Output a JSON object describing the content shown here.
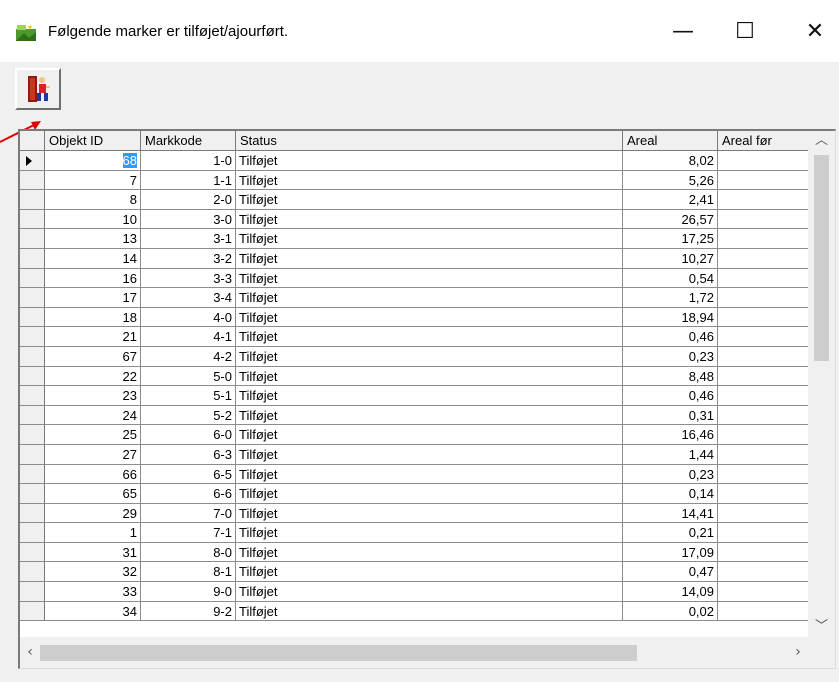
{
  "window": {
    "title": "Følgende marker er tilføjet/ajourført.",
    "minimize_glyph": "—",
    "maximize_glyph": "☐",
    "close_glyph": "✕"
  },
  "toolbar": {
    "exit_icon": "exit-door-icon"
  },
  "grid": {
    "columns": [
      "Objekt ID",
      "Markkode",
      "Status",
      "Areal",
      "Areal før"
    ],
    "rows": [
      {
        "id": "68",
        "code": "1-0",
        "status": "Tilføjet",
        "areal": "8,02",
        "areal_for": ""
      },
      {
        "id": "7",
        "code": "1-1",
        "status": "Tilføjet",
        "areal": "5,26",
        "areal_for": ""
      },
      {
        "id": "8",
        "code": "2-0",
        "status": "Tilføjet",
        "areal": "2,41",
        "areal_for": ""
      },
      {
        "id": "10",
        "code": "3-0",
        "status": "Tilføjet",
        "areal": "26,57",
        "areal_for": ""
      },
      {
        "id": "13",
        "code": "3-1",
        "status": "Tilføjet",
        "areal": "17,25",
        "areal_for": ""
      },
      {
        "id": "14",
        "code": "3-2",
        "status": "Tilføjet",
        "areal": "10,27",
        "areal_for": ""
      },
      {
        "id": "16",
        "code": "3-3",
        "status": "Tilføjet",
        "areal": "0,54",
        "areal_for": ""
      },
      {
        "id": "17",
        "code": "3-4",
        "status": "Tilføjet",
        "areal": "1,72",
        "areal_for": ""
      },
      {
        "id": "18",
        "code": "4-0",
        "status": "Tilføjet",
        "areal": "18,94",
        "areal_for": ""
      },
      {
        "id": "21",
        "code": "4-1",
        "status": "Tilføjet",
        "areal": "0,46",
        "areal_for": ""
      },
      {
        "id": "67",
        "code": "4-2",
        "status": "Tilføjet",
        "areal": "0,23",
        "areal_for": ""
      },
      {
        "id": "22",
        "code": "5-0",
        "status": "Tilføjet",
        "areal": "8,48",
        "areal_for": ""
      },
      {
        "id": "23",
        "code": "5-1",
        "status": "Tilføjet",
        "areal": "0,46",
        "areal_for": ""
      },
      {
        "id": "24",
        "code": "5-2",
        "status": "Tilføjet",
        "areal": "0,31",
        "areal_for": ""
      },
      {
        "id": "25",
        "code": "6-0",
        "status": "Tilføjet",
        "areal": "16,46",
        "areal_for": ""
      },
      {
        "id": "27",
        "code": "6-3",
        "status": "Tilføjet",
        "areal": "1,44",
        "areal_for": ""
      },
      {
        "id": "66",
        "code": "6-5",
        "status": "Tilføjet",
        "areal": "0,23",
        "areal_for": ""
      },
      {
        "id": "65",
        "code": "6-6",
        "status": "Tilføjet",
        "areal": "0,14",
        "areal_for": ""
      },
      {
        "id": "29",
        "code": "7-0",
        "status": "Tilføjet",
        "areal": "14,41",
        "areal_for": ""
      },
      {
        "id": "1",
        "code": "7-1",
        "status": "Tilføjet",
        "areal": "0,21",
        "areal_for": ""
      },
      {
        "id": "31",
        "code": "8-0",
        "status": "Tilføjet",
        "areal": "17,09",
        "areal_for": ""
      },
      {
        "id": "32",
        "code": "8-1",
        "status": "Tilføjet",
        "areal": "0,47",
        "areal_for": ""
      },
      {
        "id": "33",
        "code": "9-0",
        "status": "Tilføjet",
        "areal": "14,09",
        "areal_for": ""
      },
      {
        "id": "34",
        "code": "9-2",
        "status": "Tilføjet",
        "areal": "0,02",
        "areal_for": ""
      }
    ]
  },
  "colors": {
    "selection": "#3399ff",
    "annotation_arrow": "#e00000",
    "window_bg": "#f0f0f0"
  }
}
